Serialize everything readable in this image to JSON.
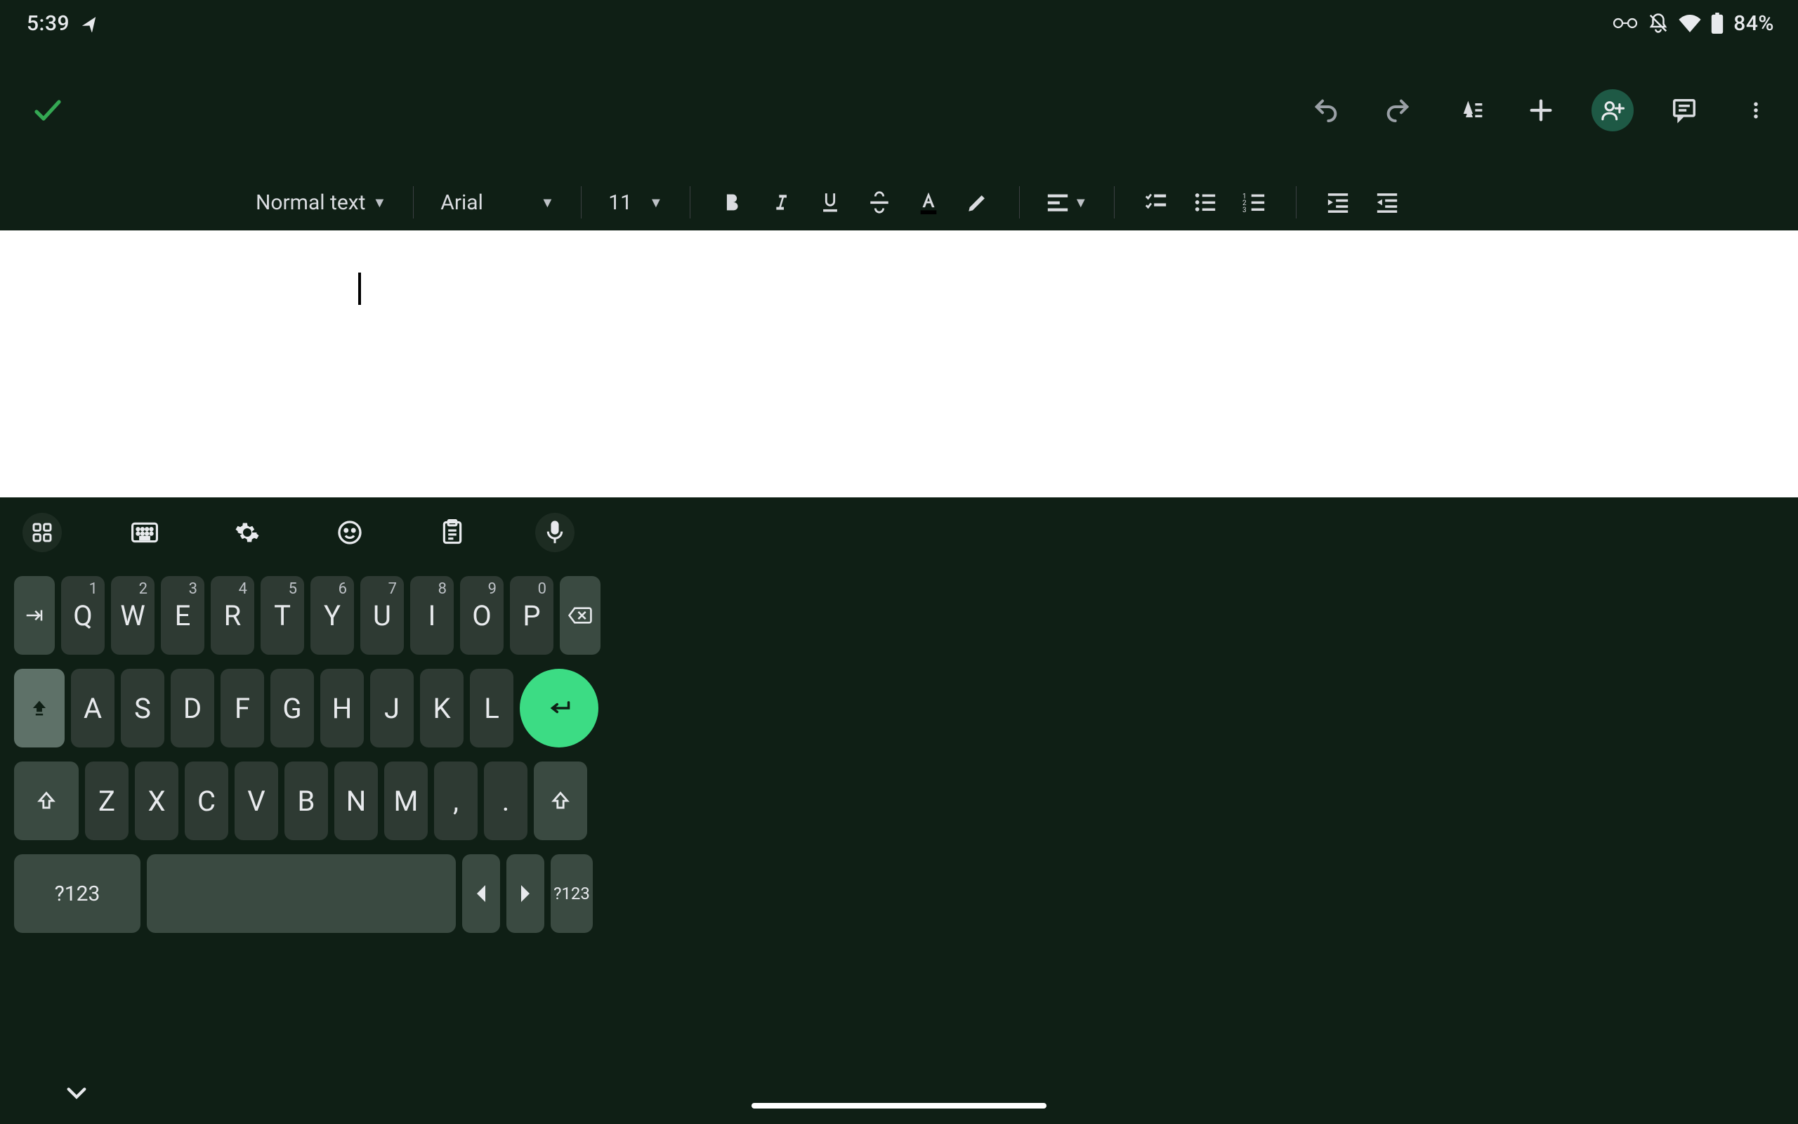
{
  "status": {
    "time": "5:39",
    "battery": "84%"
  },
  "format": {
    "style": "Normal text",
    "font": "Arial",
    "size": "11"
  },
  "keyboard": {
    "row1": [
      {
        "main": "Q",
        "sup": "1"
      },
      {
        "main": "W",
        "sup": "2"
      },
      {
        "main": "E",
        "sup": "3"
      },
      {
        "main": "R",
        "sup": "4"
      },
      {
        "main": "T",
        "sup": "5"
      },
      {
        "main": "Y",
        "sup": "6"
      },
      {
        "main": "U",
        "sup": "7"
      },
      {
        "main": "I",
        "sup": "8"
      },
      {
        "main": "O",
        "sup": "9"
      },
      {
        "main": "P",
        "sup": "0"
      }
    ],
    "row2": [
      "A",
      "S",
      "D",
      "F",
      "G",
      "H",
      "J",
      "K",
      "L"
    ],
    "row3": [
      "Z",
      "X",
      "C",
      "V",
      "B",
      "N",
      "M",
      ",",
      "."
    ],
    "sym": "?123",
    "sym_r": "?123"
  }
}
